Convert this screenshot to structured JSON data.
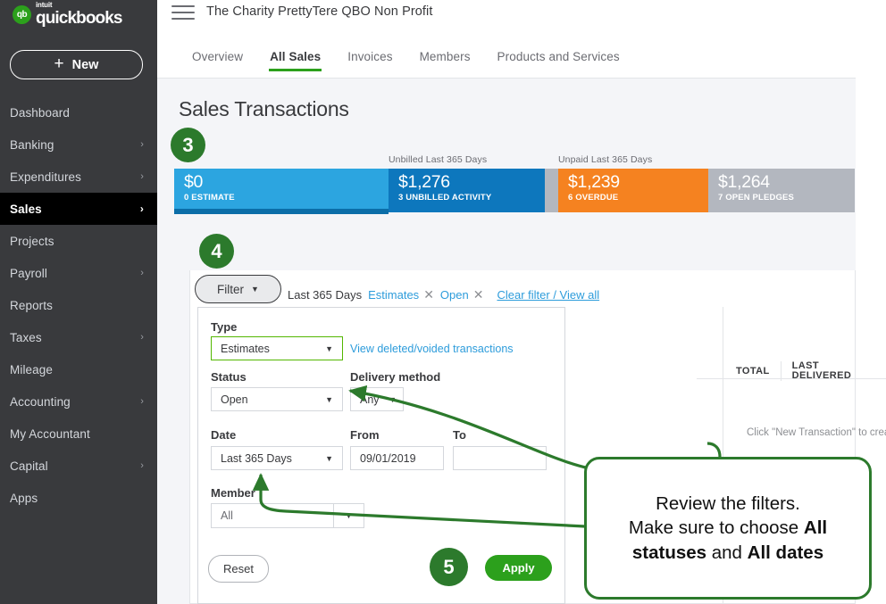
{
  "sidebar": {
    "brand": {
      "intuit": "intuit",
      "name": "quickbooks",
      "logo_text": "qb"
    },
    "new_button": {
      "label": "New",
      "plus": "+"
    },
    "items": [
      {
        "label": "Dashboard",
        "caret": "",
        "active": false
      },
      {
        "label": "Banking",
        "caret": "›",
        "active": false
      },
      {
        "label": "Expenditures",
        "caret": "›",
        "active": false
      },
      {
        "label": "Sales",
        "caret": "›",
        "active": true
      },
      {
        "label": "Projects",
        "caret": "",
        "active": false
      },
      {
        "label": "Payroll",
        "caret": "›",
        "active": false
      },
      {
        "label": "Reports",
        "caret": "",
        "active": false
      },
      {
        "label": "Taxes",
        "caret": "›",
        "active": false
      },
      {
        "label": "Mileage",
        "caret": "",
        "active": false
      },
      {
        "label": "Accounting",
        "caret": "›",
        "active": false
      },
      {
        "label": "My Accountant",
        "caret": "",
        "active": false
      },
      {
        "label": "Capital",
        "caret": "›",
        "active": false
      },
      {
        "label": "Apps",
        "caret": "",
        "active": false
      }
    ]
  },
  "header": {
    "company_title": "The Charity PrettyTere QBO Non Profit",
    "tabs": [
      {
        "label": "Overview",
        "active": false
      },
      {
        "label": "All Sales",
        "active": true
      },
      {
        "label": "Invoices",
        "active": false
      },
      {
        "label": "Members",
        "active": false
      },
      {
        "label": "Products and Services",
        "active": false
      }
    ]
  },
  "page": {
    "title": "Sales Transactions"
  },
  "money_bar": {
    "captions": [
      {
        "text": "Unbilled Last 365 Days"
      },
      {
        "text": "Unpaid Last 365 Days"
      }
    ],
    "tiles": [
      {
        "amount": "$0",
        "sublabel": "0 ESTIMATE",
        "color": "#2ca5e0"
      },
      {
        "amount": "$1,276",
        "sublabel": "3 UNBILLED ACTIVITY",
        "color": "#0d77bd"
      },
      {
        "amount": "$1,239",
        "sublabel": "6 OVERDUE",
        "color": "#f58220"
      },
      {
        "amount": "$1,264",
        "sublabel": "7 OPEN PLEDGES",
        "color": "#b3b7bf"
      }
    ],
    "underline_color": "#0b6ea8",
    "gap_color": "#b3b7bf"
  },
  "filter_bar": {
    "button_label": "Filter",
    "button_caret": "▼",
    "chips": [
      {
        "text": "Last 365 Days",
        "type": "static",
        "removable": false
      },
      {
        "text": "Estimates",
        "type": "link",
        "removable": true
      },
      {
        "text": "Open",
        "type": "link",
        "removable": true
      }
    ],
    "remove_glyph": "✕",
    "clear_link": "Clear filter / View all"
  },
  "filter_panel": {
    "type": {
      "label": "Type",
      "value": "Estimates",
      "caret": "▼"
    },
    "view_deleted_link": "View deleted/voided transactions",
    "status": {
      "label": "Status",
      "value": "Open",
      "caret": "▼"
    },
    "delivery_method": {
      "label": "Delivery method",
      "value": "Any",
      "caret": "▼"
    },
    "date": {
      "label": "Date",
      "value": "Last 365 Days",
      "caret": "▼"
    },
    "from": {
      "label": "From",
      "value": "09/01/2019",
      "placeholder": ""
    },
    "to": {
      "label": "To",
      "value": "",
      "placeholder": ""
    },
    "member": {
      "label": "Member",
      "value": "All",
      "caret": "▼"
    },
    "reset_label": "Reset",
    "apply_label": "Apply"
  },
  "table": {
    "headers": [
      "TOTAL",
      "LAST DELIVERED"
    ],
    "empty_message": "Click \"New Transaction\" to create a new open estimate"
  },
  "annotations": {
    "badges": [
      {
        "number": "3"
      },
      {
        "number": "4"
      },
      {
        "number": "5"
      }
    ],
    "callout": {
      "line1": "Review the filters.",
      "line2_a": "Make sure to choose ",
      "line2_b": "All",
      "line3_a": "statuses",
      "line3_b": " and ",
      "line3_c": "All dates"
    },
    "accent_color": "#2c7a2c"
  }
}
